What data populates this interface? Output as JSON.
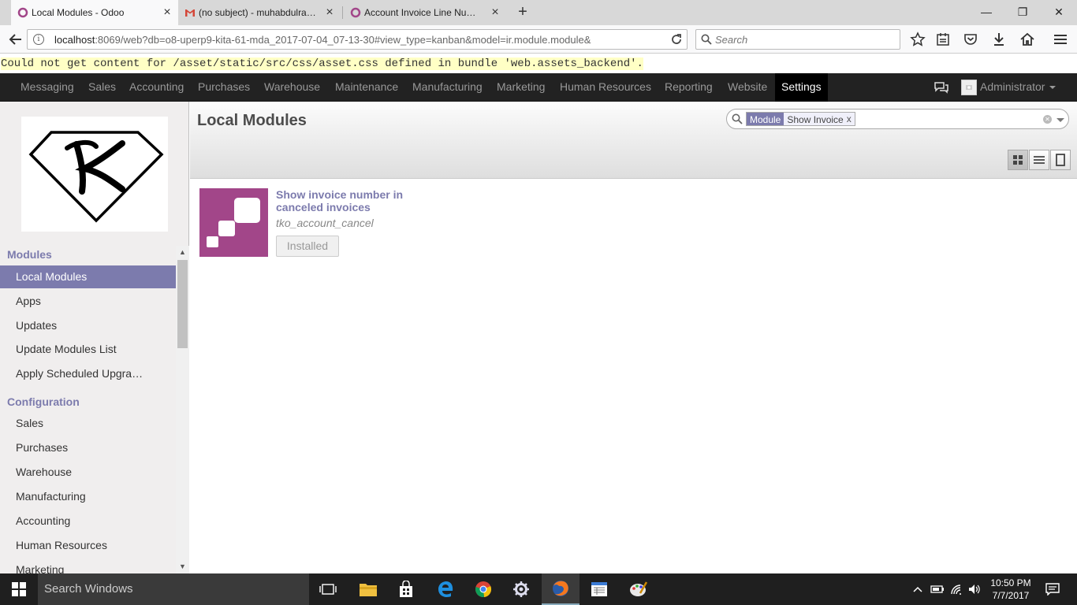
{
  "browser": {
    "tabs": [
      {
        "title": "Local Modules - Odoo",
        "active": true
      },
      {
        "title": "(no subject) - muhabdulra…",
        "active": false
      },
      {
        "title": "Account Invoice Line Nu…",
        "active": false
      }
    ],
    "url_host": "localhost",
    "url_rest": ":8069/web?db=o8-uperp9-kita-61-mda_2017-07-04_07-13-30#view_type=kanban&model=ir.module.module&",
    "search_placeholder": "Search",
    "window_controls": {
      "minimize": "—",
      "maximize": "❐",
      "close": "✕"
    }
  },
  "error_message": "Could not get content for /asset/static/src/css/asset.css defined in bundle 'web.assets_backend'.",
  "odoo_menu": {
    "items": [
      "Messaging",
      "Sales",
      "Accounting",
      "Purchases",
      "Warehouse",
      "Maintenance",
      "Manufacturing",
      "Marketing",
      "Human Resources",
      "Reporting",
      "Website",
      "Settings"
    ],
    "active": "Settings",
    "user": "Administrator"
  },
  "sidebar": {
    "modules_heading": "Modules",
    "modules_items": [
      "Local Modules",
      "Apps",
      "Updates",
      "Update Modules List",
      "Apply Scheduled Upgra…"
    ],
    "config_heading": "Configuration",
    "config_items": [
      "Sales",
      "Purchases",
      "Warehouse",
      "Manufacturing",
      "Accounting",
      "Human Resources",
      "Marketing"
    ],
    "active_item": "Local Modules"
  },
  "main": {
    "title": "Local Modules",
    "facet_category": "Module",
    "facet_value": "Show Invoice",
    "facet_remove": "x"
  },
  "module_card": {
    "title": "Show invoice number in canceled invoices",
    "technical_name": "tko_account_cancel",
    "status_button": "Installed"
  },
  "taskbar": {
    "search_text": "Search Windows",
    "time": "10:50 PM",
    "date": "7/7/2017"
  },
  "colors": {
    "accent": "#7c7bad",
    "module_icon": "#a24689",
    "menu_bg": "#222222"
  }
}
